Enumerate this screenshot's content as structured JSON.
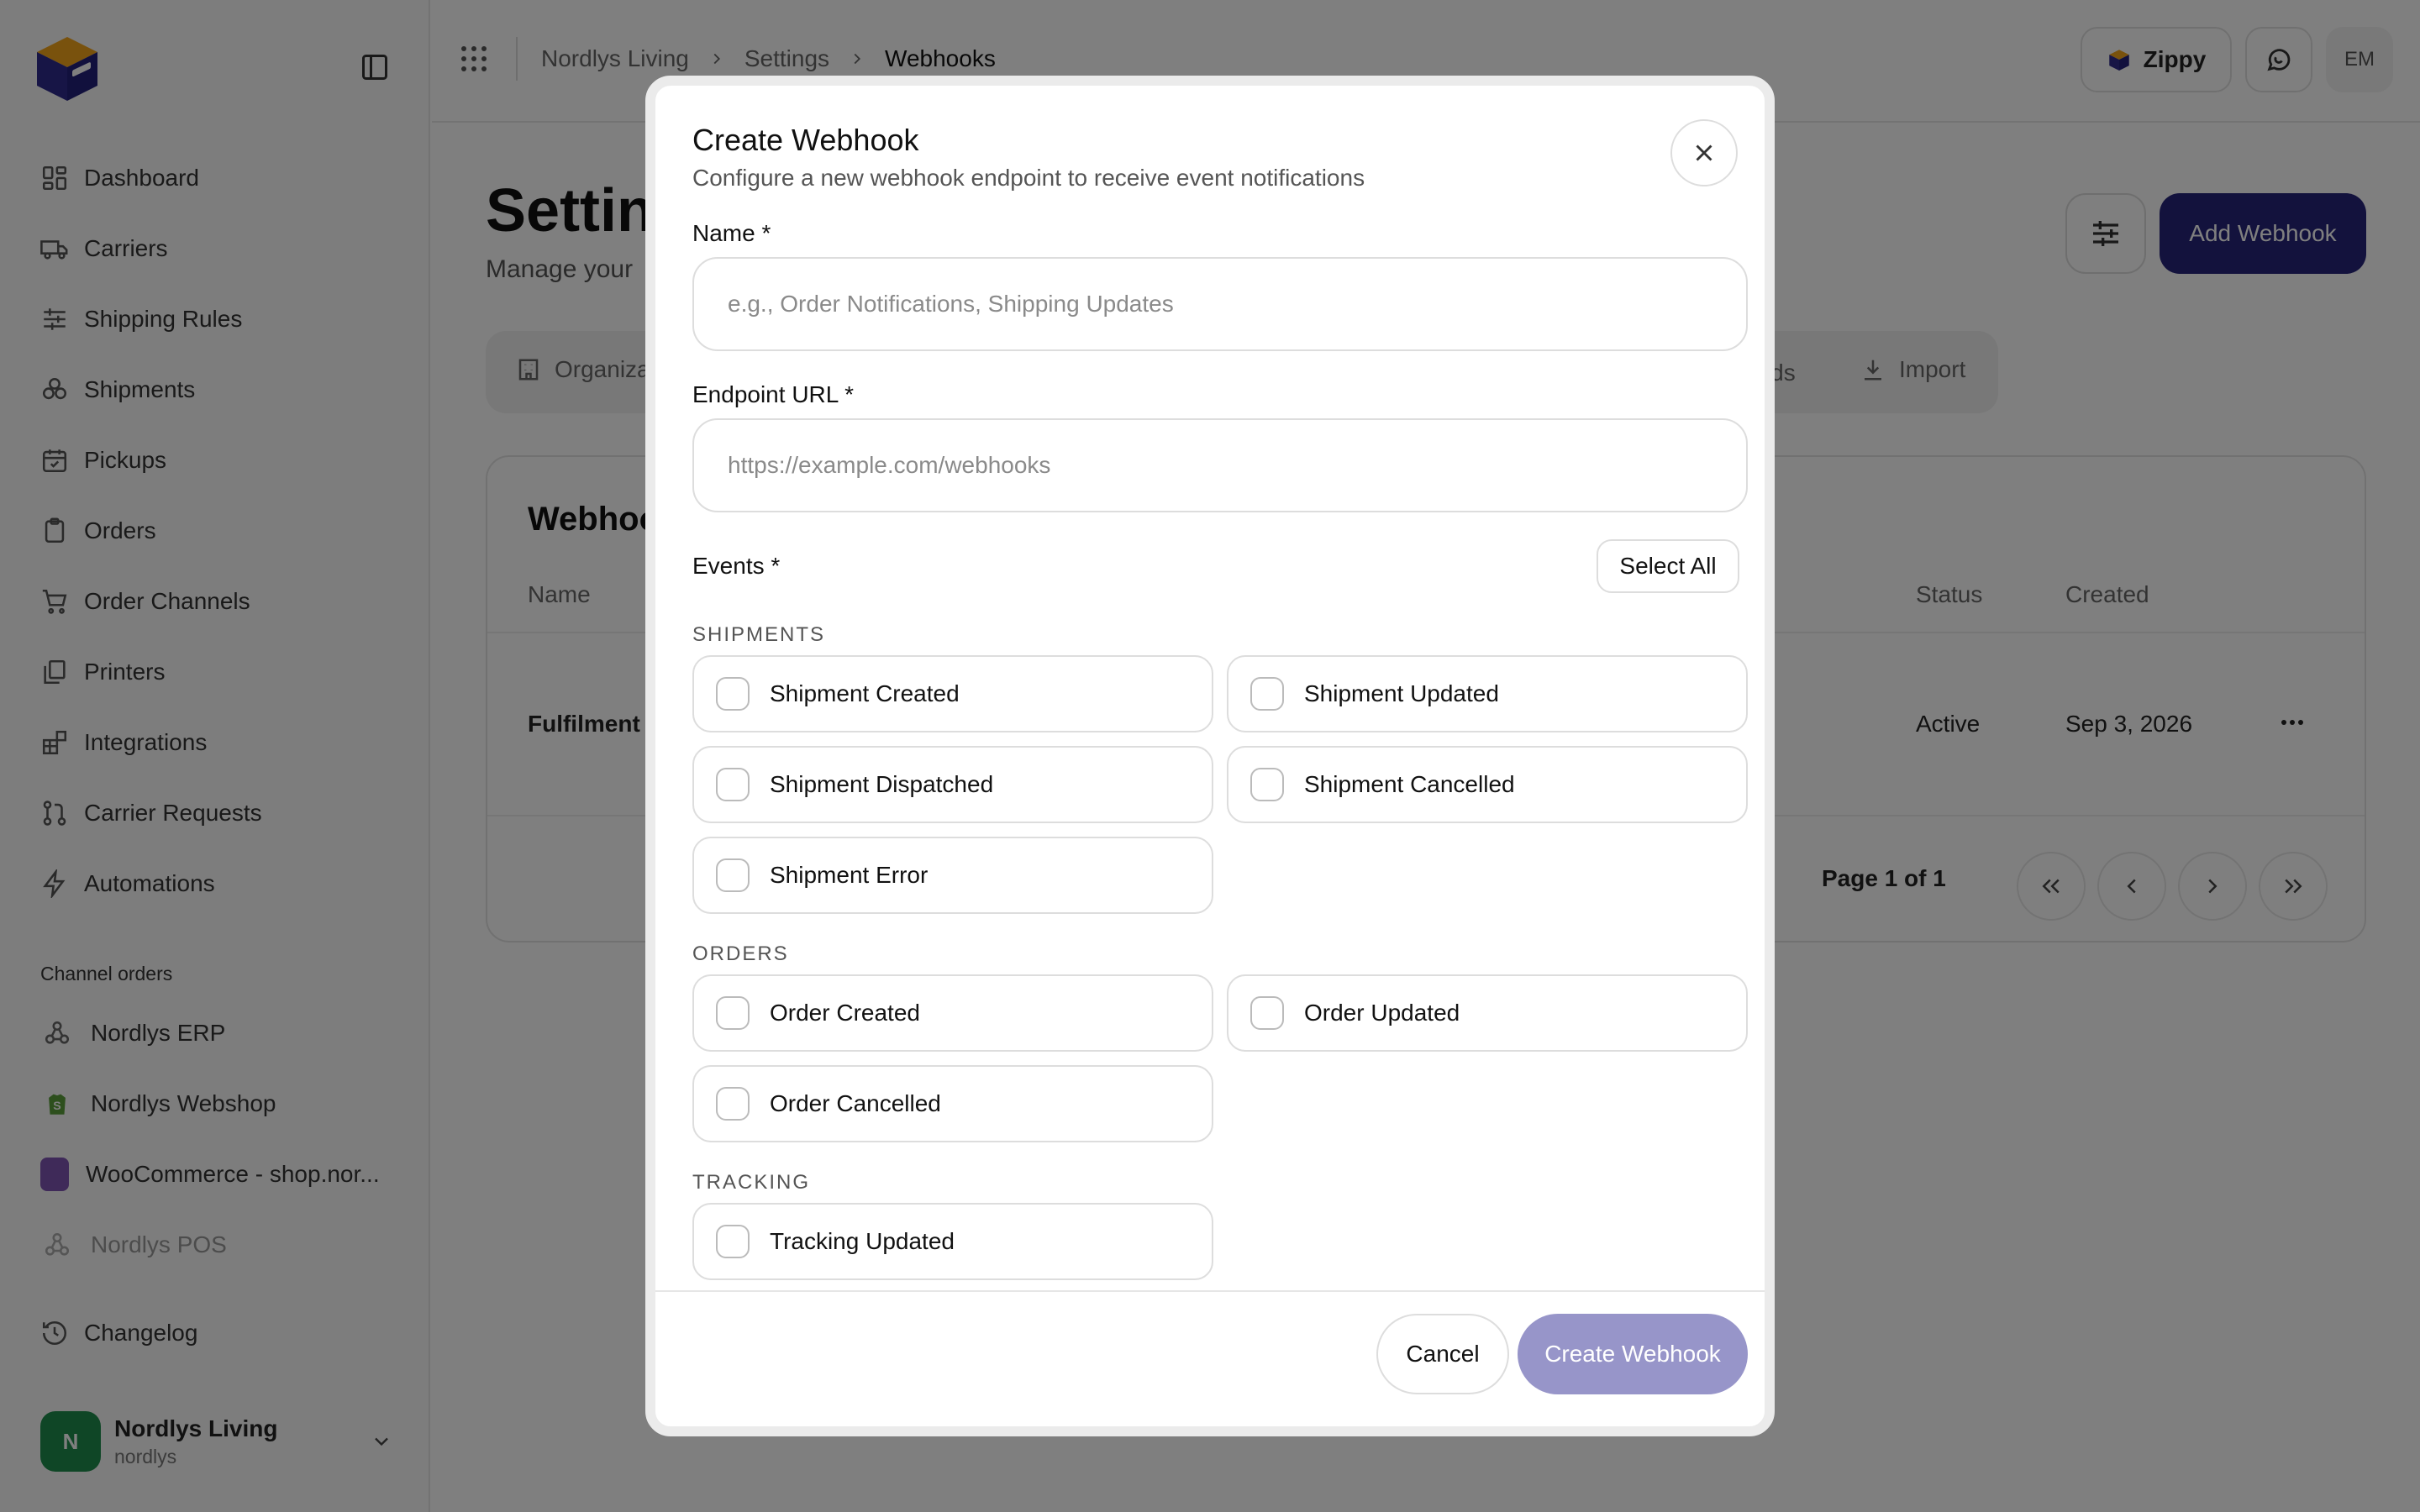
{
  "breadcrumb": [
    "Nordlys Living",
    "Settings",
    "Webhooks"
  ],
  "topbar": {
    "assistant_label": "Zippy",
    "user_initials": "EM"
  },
  "sidebar": {
    "items": [
      {
        "label": "Dashboard",
        "icon": "dashboard-icon"
      },
      {
        "label": "Carriers",
        "icon": "truck-icon"
      },
      {
        "label": "Shipping Rules",
        "icon": "sliders-icon"
      },
      {
        "label": "Shipments",
        "icon": "boxes-icon"
      },
      {
        "label": "Pickups",
        "icon": "calendar-icon"
      },
      {
        "label": "Orders",
        "icon": "clipboard-icon"
      },
      {
        "label": "Order Channels",
        "icon": "cart-icon"
      },
      {
        "label": "Printers",
        "icon": "printer-icon"
      },
      {
        "label": "Integrations",
        "icon": "blocks-icon"
      },
      {
        "label": "Carrier Requests",
        "icon": "git-pull-icon"
      },
      {
        "label": "Automations",
        "icon": "zap-icon"
      }
    ],
    "channels_title": "Channel orders",
    "channels": [
      {
        "label": "Nordlys ERP",
        "icon": "webhook-icon"
      },
      {
        "label": "Nordlys Webshop",
        "icon": "shopify-icon"
      },
      {
        "label": "WooCommerce - shop.nor...",
        "icon": "woocommerce-icon"
      },
      {
        "label": "Nordlys POS",
        "icon": "webhook-icon"
      }
    ],
    "changelog": "Changelog",
    "account": {
      "initial": "N",
      "name": "Nordlys Living",
      "handle": "nordlys"
    }
  },
  "main": {
    "title_visible": "Settin",
    "subtitle_visible": "Manage your",
    "add_button": "Add Webhook",
    "tabs": {
      "organization_visible": "Organiza",
      "commands_visible": "ands",
      "import": "Import"
    },
    "card": {
      "title_visible": "Webhoo",
      "columns": {
        "name": "Name",
        "status": "Status",
        "created": "Created"
      },
      "rows": [
        {
          "name_visible": "Fulfilment r",
          "status": "Active",
          "created": "Sep 3, 2026"
        }
      ],
      "pagination": "Page 1 of 1"
    }
  },
  "modal": {
    "title": "Create Webhook",
    "subtitle": "Configure a new webhook endpoint to receive event notifications",
    "name_label": "Name *",
    "name_placeholder": "e.g., Order Notifications, Shipping Updates",
    "url_label": "Endpoint URL *",
    "url_placeholder": "https://example.com/webhooks",
    "events_label": "Events *",
    "select_all": "Select All",
    "groups": {
      "shipments": {
        "title": "SHIPMENTS",
        "events": [
          "Shipment Created",
          "Shipment Updated",
          "Shipment Dispatched",
          "Shipment Cancelled",
          "Shipment Error"
        ]
      },
      "orders": {
        "title": "ORDERS",
        "events": [
          "Order Created",
          "Order Updated",
          "Order Cancelled"
        ]
      },
      "tracking": {
        "title": "TRACKING",
        "events": [
          "Tracking Updated"
        ]
      }
    },
    "cancel": "Cancel",
    "create": "Create Webhook"
  },
  "colors": {
    "primary": "#27247a",
    "primary_disabled": "#9795c9",
    "overlay": "rgba(0,0,0,0.5)",
    "account_green": "#1e8c4c"
  }
}
